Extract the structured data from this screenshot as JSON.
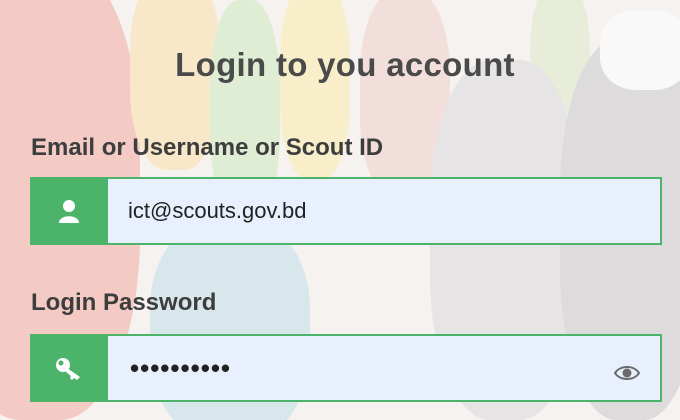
{
  "form": {
    "title": "Login to you account",
    "email": {
      "label": "Email or Username or Scout ID",
      "value": "ict@scouts.gov.bd",
      "icon": "user-icon"
    },
    "password": {
      "label": "Login Password",
      "value": "••••••••••",
      "icon": "key-icon",
      "toggle_icon": "eye-icon"
    }
  },
  "colors": {
    "accent": "#4cb46a",
    "input_bg": "#e8f0fd",
    "text": "#3d3d3d"
  }
}
